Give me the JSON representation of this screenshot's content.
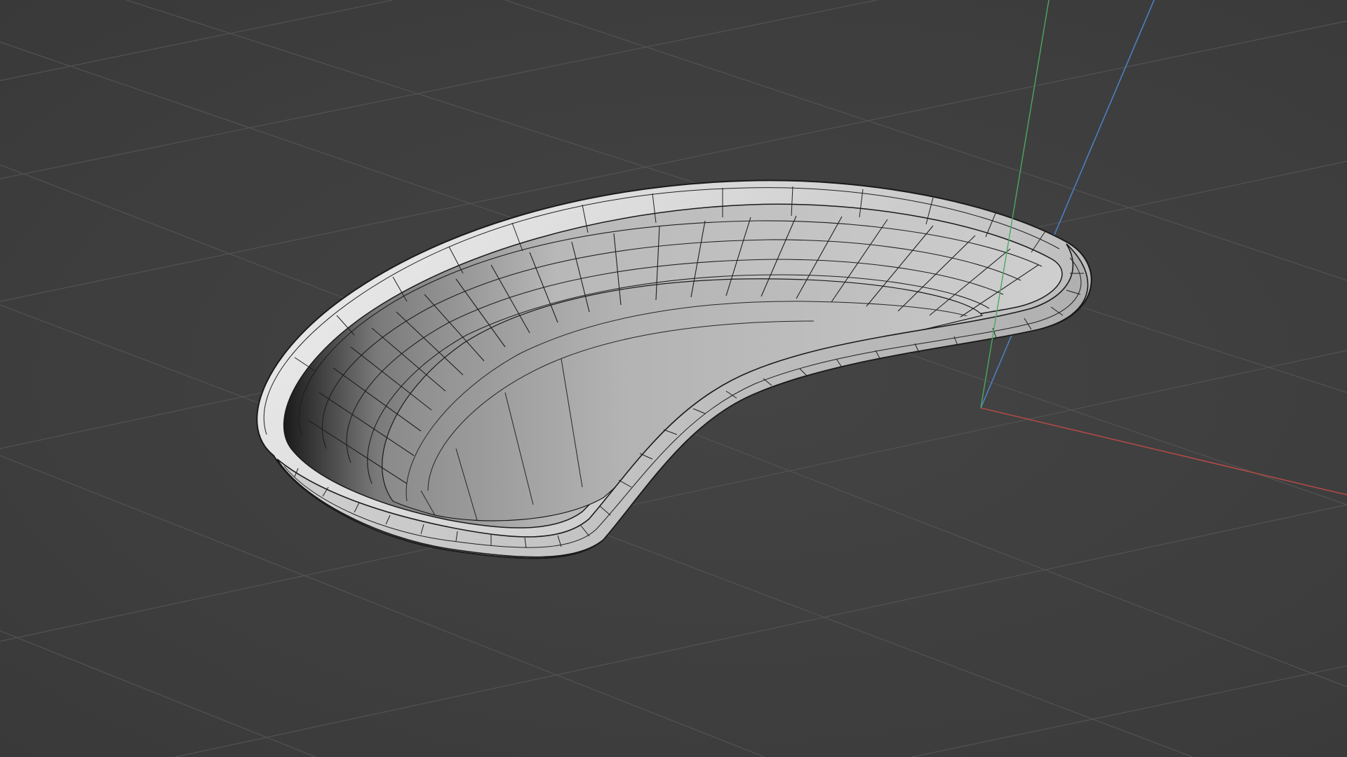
{
  "viewport": {
    "background_color": "#404040",
    "grid_color": "#4d4d4d",
    "axis_colors": {
      "x": "#b04a45",
      "y": "#4aa860",
      "z": "#4d7ec0"
    }
  },
  "model": {
    "shape": "kidney-dish",
    "surface_color": "#d9d9d9",
    "wire_color": "#1a1a1a",
    "display": "shaded-wireframe"
  }
}
